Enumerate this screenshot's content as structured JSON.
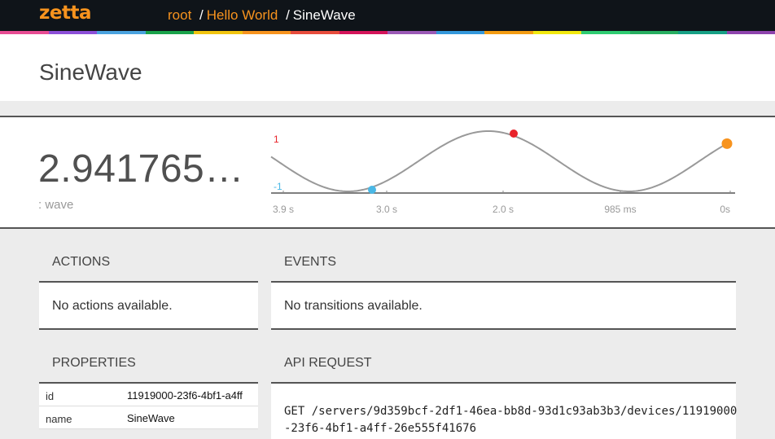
{
  "header": {
    "logo": "zetta",
    "breadcrumbs": [
      {
        "label": "root"
      },
      {
        "label": "Hello World"
      },
      {
        "label": "SineWave"
      }
    ],
    "separator": "/",
    "stripe_colors": [
      "#e84c93",
      "#8c4fd8",
      "#4aa3df",
      "#1aa34a",
      "#f1c40f",
      "#f7931e",
      "#e74c3c",
      "#d4145a",
      "#9b59b6",
      "#3498db",
      "#f39c12",
      "#f1e80f",
      "#2ecc71",
      "#27ae60",
      "#16a085",
      "#8e44ad"
    ]
  },
  "page": {
    "title": "SineWave"
  },
  "stream": {
    "value": "2.941765…",
    "label": ": wave",
    "max_label": "1",
    "min_label": "-1",
    "max_color": "#e8232a",
    "min_color": "#4ab8e6",
    "current_color": "#f7931e",
    "line_color": "#999999"
  },
  "chart_data": {
    "type": "line",
    "x_ticks": [
      "3.9 s",
      "3.0 s",
      "2.0 s",
      "985 ms",
      "0s"
    ],
    "ylim": [
      -1,
      1
    ],
    "y_labels": {
      "max": "1",
      "min": "-1"
    }
  },
  "actions": {
    "title": "ACTIONS",
    "empty": "No actions available."
  },
  "events": {
    "title": "EVENTS",
    "empty": "No transitions available."
  },
  "properties": {
    "title": "PROPERTIES",
    "rows": [
      {
        "key": "id",
        "value": "11919000-23f6-4bf1-a4ff"
      },
      {
        "key": "name",
        "value": "SineWave"
      }
    ]
  },
  "api": {
    "title": "API REQUEST",
    "request": "GET /servers/9d359bcf-2df1-46ea-bb8d-93d1c93ab3b3/devices/11919000-23f6-4bf1-a4ff-26e555f41676"
  }
}
